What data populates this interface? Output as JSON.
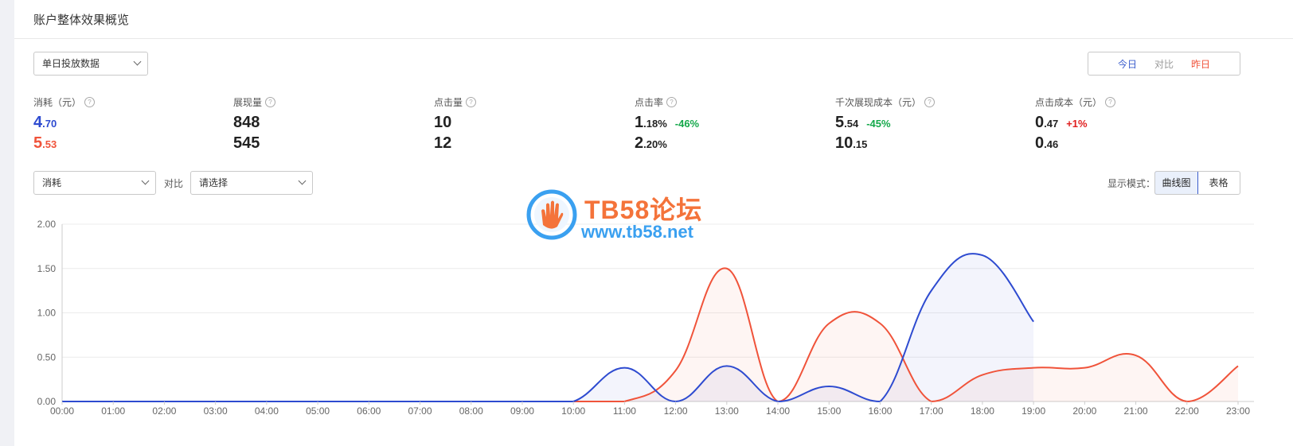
{
  "panel": {
    "title": "账户整体效果概览"
  },
  "data_select": {
    "value": "单日投放数据"
  },
  "day_toggle": {
    "today": "今日",
    "compare": "对比",
    "yesterday": "昨日"
  },
  "metrics": [
    {
      "label": "消耗（元）",
      "today_int": "4",
      "today_dec": ".70",
      "yest_int": "5",
      "yest_dec": ".53",
      "delta": ""
    },
    {
      "label": "展现量",
      "today_int": "848",
      "today_dec": "",
      "yest_int": "545",
      "yest_dec": "",
      "delta": ""
    },
    {
      "label": "点击量",
      "today_int": "10",
      "today_dec": "",
      "yest_int": "12",
      "yest_dec": "",
      "delta": ""
    },
    {
      "label": "点击率",
      "today_int": "1",
      "today_dec": ".18%",
      "yest_int": "2",
      "yest_dec": ".20%",
      "delta": "-46%"
    },
    {
      "label": "千次展现成本（元）",
      "today_int": "5",
      "today_dec": ".54",
      "yest_int": "10",
      "yest_dec": ".15",
      "delta": "-45%"
    },
    {
      "label": "点击成本（元）",
      "today_int": "0",
      "today_dec": ".47",
      "yest_int": "0",
      "yest_dec": ".46",
      "delta": "+1%"
    }
  ],
  "help_glyph": "?",
  "metric_select": {
    "value": "消耗"
  },
  "compare_label": "对比",
  "compare_select": {
    "value": "请选择"
  },
  "mode": {
    "label": "显示模式：",
    "curve": "曲线图",
    "table": "表格"
  },
  "watermark": {
    "title": "TB58论坛",
    "url": "www.tb58.net"
  },
  "colors": {
    "today": "#2e4bd0",
    "yesterday": "#f0533a",
    "grid": "#ececec"
  },
  "chart_data": {
    "type": "area",
    "categories": [
      "00:00",
      "01:00",
      "02:00",
      "03:00",
      "04:00",
      "05:00",
      "06:00",
      "07:00",
      "08:00",
      "09:00",
      "10:00",
      "11:00",
      "12:00",
      "13:00",
      "14:00",
      "15:00",
      "16:00",
      "17:00",
      "18:00",
      "19:00",
      "20:00",
      "21:00",
      "22:00",
      "23:00"
    ],
    "y_ticks": [
      "0.00",
      "0.50",
      "1.00",
      "1.50",
      "2.00"
    ],
    "ylim": [
      0,
      2
    ],
    "series": [
      {
        "key": "today",
        "values": [
          0,
          0,
          0,
          0,
          0,
          0,
          0,
          0,
          0,
          0,
          0,
          0.38,
          0,
          0.4,
          0,
          0.17,
          0,
          1.25,
          1.65,
          0.9
        ]
      },
      {
        "key": "yesterday",
        "values": [
          0,
          0,
          0,
          0,
          0,
          0,
          0,
          0,
          0,
          0,
          0,
          0,
          0.35,
          1.5,
          0,
          0.88,
          0.88,
          0,
          0.3,
          0.38,
          0.38,
          0.52,
          0,
          0.4
        ]
      }
    ]
  }
}
